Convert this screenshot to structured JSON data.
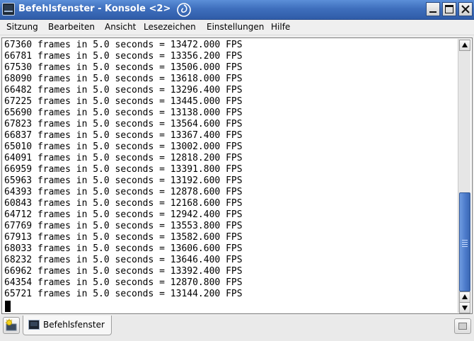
{
  "window": {
    "title": "Befehlsfenster - Konsole <2>"
  },
  "menu": [
    "Sitzung",
    "Bearbeiten",
    "Ansicht",
    "Lesezeichen",
    "Einstellungen",
    "Hilfe"
  ],
  "terminal": {
    "lines": [
      "67360 frames in 5.0 seconds = 13472.000 FPS",
      "66781 frames in 5.0 seconds = 13356.200 FPS",
      "67530 frames in 5.0 seconds = 13506.000 FPS",
      "68090 frames in 5.0 seconds = 13618.000 FPS",
      "66482 frames in 5.0 seconds = 13296.400 FPS",
      "67225 frames in 5.0 seconds = 13445.000 FPS",
      "65690 frames in 5.0 seconds = 13138.000 FPS",
      "67823 frames in 5.0 seconds = 13564.600 FPS",
      "66837 frames in 5.0 seconds = 13367.400 FPS",
      "65010 frames in 5.0 seconds = 13002.000 FPS",
      "64091 frames in 5.0 seconds = 12818.200 FPS",
      "66959 frames in 5.0 seconds = 13391.800 FPS",
      "65963 frames in 5.0 seconds = 13192.600 FPS",
      "64393 frames in 5.0 seconds = 12878.600 FPS",
      "60843 frames in 5.0 seconds = 12168.600 FPS",
      "64712 frames in 5.0 seconds = 12942.400 FPS",
      "67769 frames in 5.0 seconds = 13553.800 FPS",
      "67913 frames in 5.0 seconds = 13582.600 FPS",
      "68033 frames in 5.0 seconds = 13606.600 FPS",
      "68232 frames in 5.0 seconds = 13646.400 FPS",
      "66962 frames in 5.0 seconds = 13392.400 FPS",
      "64354 frames in 5.0 seconds = 12870.800 FPS",
      "65721 frames in 5.0 seconds = 13144.200 FPS"
    ]
  },
  "tabs": [
    {
      "label": "Befehlsfenster",
      "icon": "terminal-icon"
    }
  ],
  "icons": {
    "app": "konsole-icon",
    "titlebar_extra": "swirl-icon",
    "new_tab": "new-session-icon",
    "close_tab": "close-session-icon"
  },
  "colors": {
    "titlebar": "#3f6fbd",
    "scroll_thumb": "#4a79c9",
    "terminal_bg": "#ffffff",
    "terminal_fg": "#000000"
  }
}
